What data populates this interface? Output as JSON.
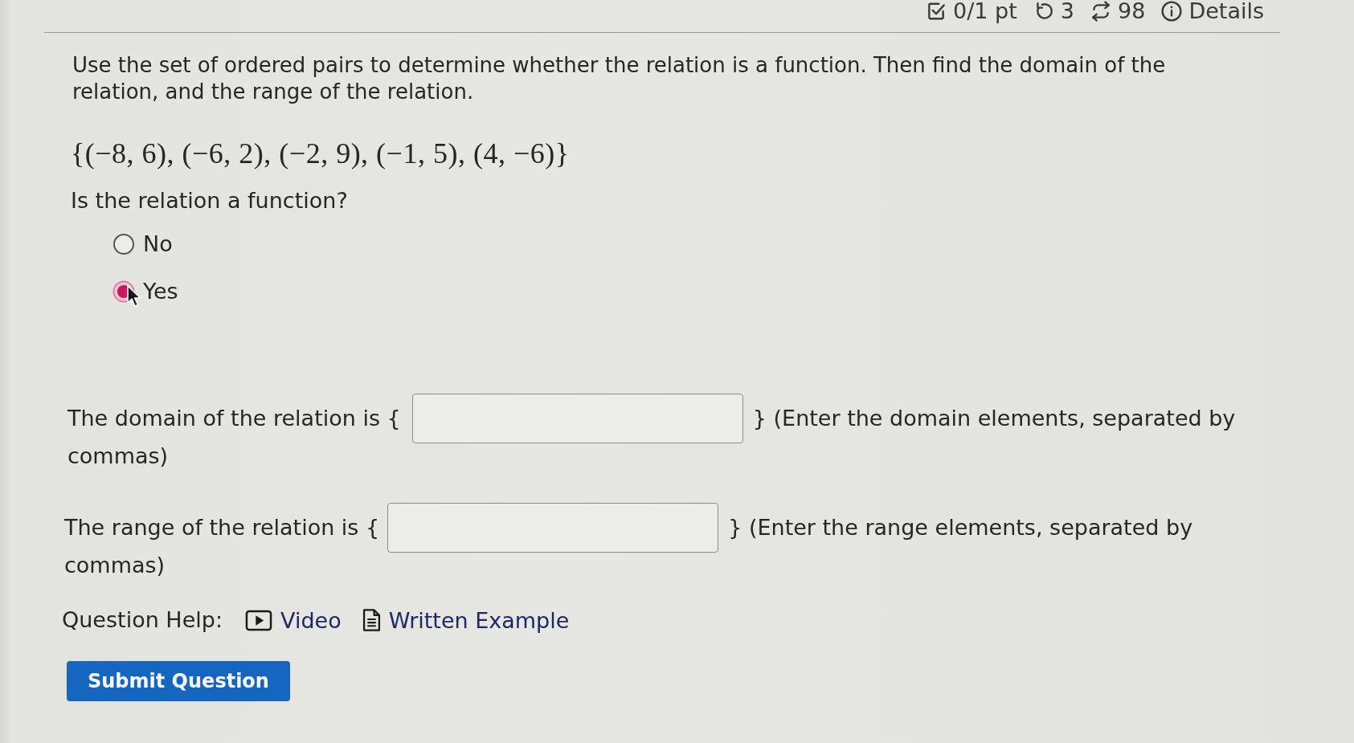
{
  "header": {
    "items": [
      {
        "kind": "score",
        "text": "0/1 pt"
      },
      {
        "kind": "retries",
        "text": "3"
      },
      {
        "kind": "attempts",
        "text": "98"
      },
      {
        "kind": "details",
        "text": "Details"
      }
    ]
  },
  "question": {
    "prompt": "Use the set of ordered pairs to determine whether the relation is a function. Then find the domain of the relation, and the range of the relation.",
    "set": "{(−8, 6), (−6, 2), (−2, 9), (−1, 5), (4, −6)}",
    "ask": "Is the relation a function?",
    "choices": [
      {
        "label": "No",
        "selected": false
      },
      {
        "label": "Yes",
        "selected": true
      }
    ],
    "answers": [
      {
        "text_before": "The domain of the relation is {",
        "text_after": "} (Enter the domain elements, separated by",
        "text_after_line_2": "commas)"
      },
      {
        "text_before": "The range of the relation is {",
        "text_after": "} (Enter the range elements, separated by",
        "text_after_line_2": "commas)"
      }
    ]
  },
  "help": {
    "label": "Question Help:",
    "links": [
      {
        "kind": "video",
        "label": "Video"
      },
      {
        "kind": "document",
        "label": "Written Example"
      }
    ]
  },
  "submit": {
    "label": "Submit Question"
  }
}
